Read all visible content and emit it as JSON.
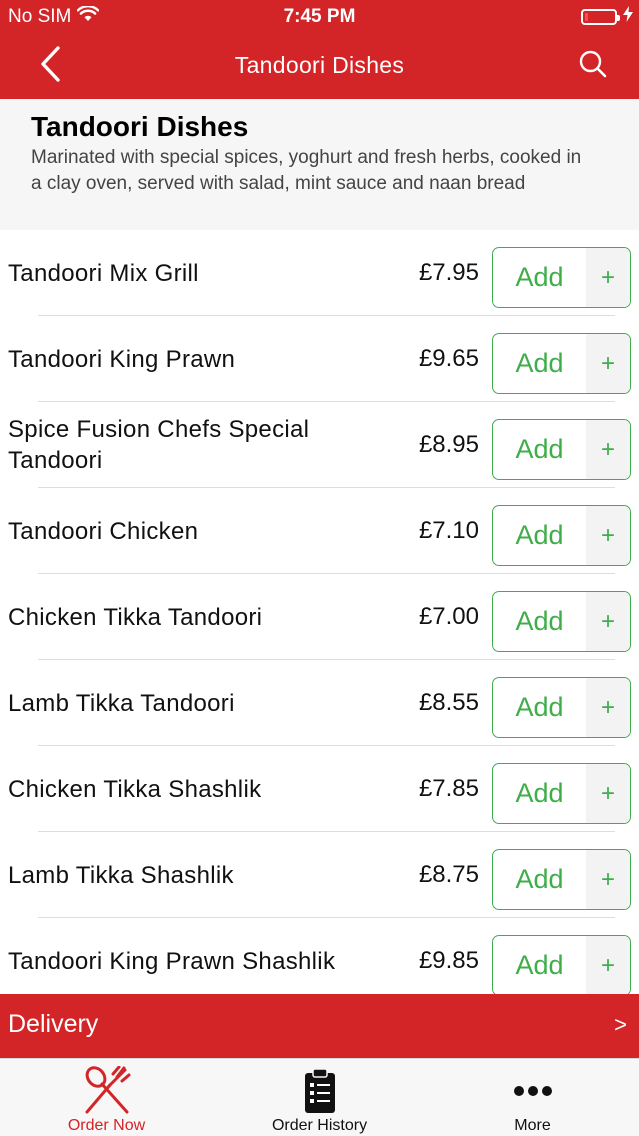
{
  "colors": {
    "brand": "#d32427",
    "accent_green": "#3fae4a"
  },
  "status_bar": {
    "carrier": "No SIM",
    "time": "7:45 PM"
  },
  "nav": {
    "title": "Tandoori Dishes",
    "back_icon": "chevron-left-icon",
    "search_icon": "search-icon"
  },
  "category": {
    "title": "Tandoori Dishes",
    "description": " Marinated with special spices, yoghurt and fresh herbs, cooked in a clay oven, served with salad, mint sauce and naan bread"
  },
  "menu": {
    "add_label": "Add",
    "plus_label": "+",
    "items": [
      {
        "name": "Tandoori Mix Grill",
        "price": "£7.95"
      },
      {
        "name": "Tandoori King Prawn",
        "price": "£9.65"
      },
      {
        "name": "Spice Fusion Chefs Special Tandoori",
        "price": "£8.95"
      },
      {
        "name": "Tandoori Chicken",
        "price": "£7.10"
      },
      {
        "name": "Chicken Tikka Tandoori",
        "price": "£7.00"
      },
      {
        "name": "Lamb Tikka Tandoori",
        "price": "£8.55"
      },
      {
        "name": "Chicken Tikka Shashlik",
        "price": "£7.85"
      },
      {
        "name": "Lamb Tikka Shashlik",
        "price": "£8.75"
      },
      {
        "name": "Tandoori King Prawn Shashlik",
        "price": "£9.85"
      }
    ]
  },
  "delivery": {
    "label": "Delivery",
    "chevron": ">"
  },
  "tabs": [
    {
      "label": "Order Now",
      "icon": "fork-knife-icon",
      "active": true
    },
    {
      "label": "Order History",
      "icon": "clipboard-icon",
      "active": false
    },
    {
      "label": "More",
      "icon": "more-dots-icon",
      "active": false
    }
  ]
}
